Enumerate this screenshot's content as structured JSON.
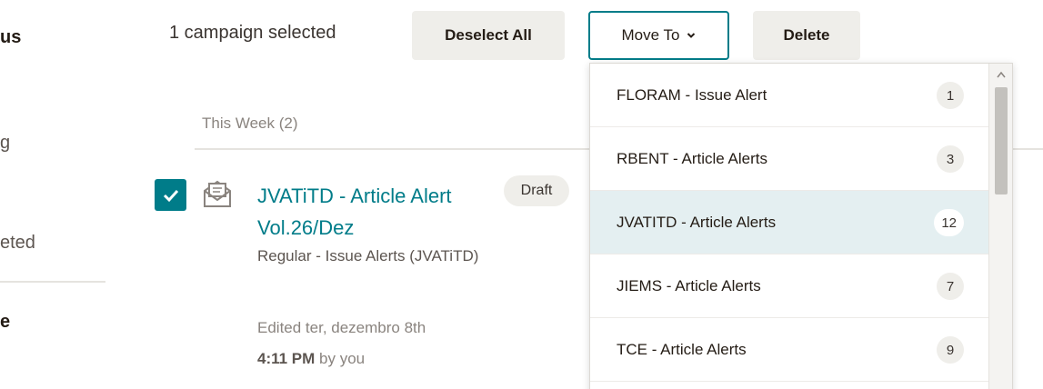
{
  "sidebar": {
    "items": [
      {
        "label": "us"
      },
      {
        "label": "g"
      },
      {
        "label": "eted"
      },
      {
        "label": "e"
      }
    ]
  },
  "toolbar": {
    "selected_text": "1 campaign selected",
    "deselect_label": "Deselect All",
    "move_label": "Move To",
    "delete_label": "Delete"
  },
  "list": {
    "section_header": "This Week (2)",
    "campaign": {
      "title": "JVATiTD - Article Alert Vol.26/Dez",
      "type": "Regular - Issue Alerts (JVATiTD)",
      "edited_prefix": "Edited ter, dezembro 8th",
      "edited_time": "4:11 PM",
      "edited_suffix": " by you",
      "status": "Draft",
      "checked": true
    }
  },
  "dropdown": {
    "items": [
      {
        "label": "FLORAM - Issue Alert",
        "count": "1"
      },
      {
        "label": "RBENT - Article Alerts",
        "count": "3"
      },
      {
        "label": "JVATITD - Article Alerts",
        "count": "12",
        "active": true
      },
      {
        "label": "JIEMS - Article Alerts",
        "count": "7"
      },
      {
        "label": "TCE - Article Alerts",
        "count": "9"
      }
    ]
  },
  "colors": {
    "accent": "#007c89",
    "highlight": "#e4eff1",
    "button_bg": "#efeeea"
  },
  "icons": {
    "checkbox": "checkmark-icon",
    "campaign": "email-campaign-icon",
    "move_to": "chevron-down-icon",
    "scroll": "scroll-up-arrow-icon"
  }
}
